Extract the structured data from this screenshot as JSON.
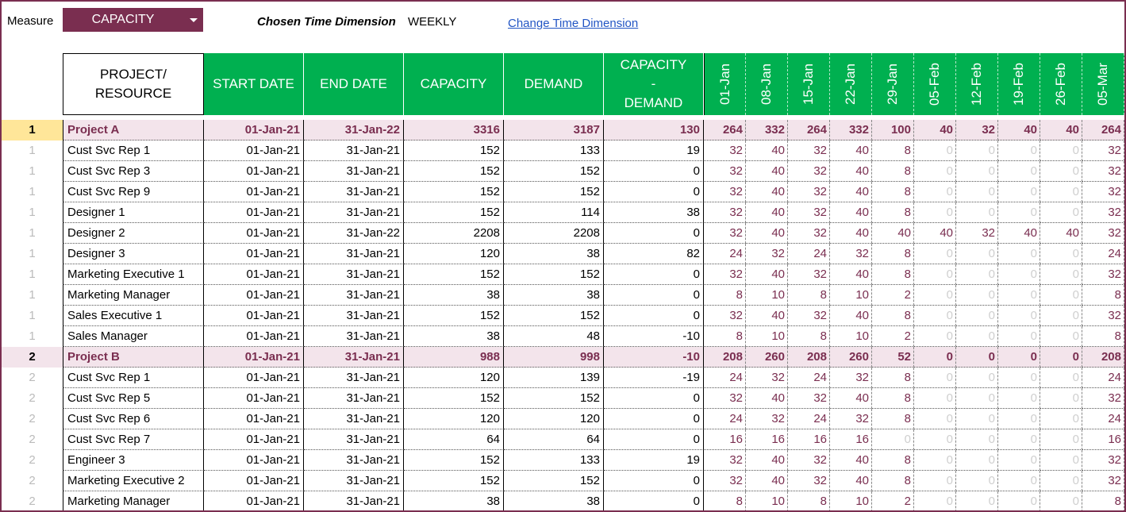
{
  "controls": {
    "measure_label": "Measure",
    "measure_value": "CAPACITY",
    "time_dimension_label": "Chosen Time Dimension",
    "time_dimension_value": "WEEKLY",
    "change_link": "Change Time Dimension"
  },
  "headers": {
    "project_line1": "PROJECT/",
    "project_line2": "RESOURCE",
    "start_date": "START DATE",
    "end_date": "END DATE",
    "capacity": "CAPACITY",
    "demand": "DEMAND",
    "cd_line1": "CAPACITY",
    "cd_line2": "-",
    "cd_line3": "DEMAND",
    "weeks": [
      "01-Jan",
      "08-Jan",
      "15-Jan",
      "22-Jan",
      "29-Jan",
      "05-Feb",
      "12-Feb",
      "19-Feb",
      "26-Feb",
      "05-Mar"
    ]
  },
  "rows": [
    {
      "idx": "1",
      "name": "Project A",
      "start": "01-Jan-21",
      "end": "31-Jan-22",
      "cap": "3316",
      "dem": "3187",
      "cd": "130",
      "weeks": [
        "264",
        "332",
        "264",
        "332",
        "100",
        "40",
        "32",
        "40",
        "40",
        "264"
      ],
      "project": true
    },
    {
      "idx": "1",
      "name": "Cust Svc Rep 1",
      "start": "01-Jan-21",
      "end": "31-Jan-21",
      "cap": "152",
      "dem": "133",
      "cd": "19",
      "weeks": [
        "32",
        "40",
        "32",
        "40",
        "8",
        "0",
        "0",
        "0",
        "0",
        "32"
      ]
    },
    {
      "idx": "1",
      "name": "Cust Svc Rep 3",
      "start": "01-Jan-21",
      "end": "31-Jan-21",
      "cap": "152",
      "dem": "152",
      "cd": "0",
      "weeks": [
        "32",
        "40",
        "32",
        "40",
        "8",
        "0",
        "0",
        "0",
        "0",
        "32"
      ]
    },
    {
      "idx": "1",
      "name": "Cust Svc Rep 9",
      "start": "01-Jan-21",
      "end": "31-Jan-21",
      "cap": "152",
      "dem": "152",
      "cd": "0",
      "weeks": [
        "32",
        "40",
        "32",
        "40",
        "8",
        "0",
        "0",
        "0",
        "0",
        "32"
      ]
    },
    {
      "idx": "1",
      "name": "Designer 1",
      "start": "01-Jan-21",
      "end": "31-Jan-21",
      "cap": "152",
      "dem": "114",
      "cd": "38",
      "weeks": [
        "32",
        "40",
        "32",
        "40",
        "8",
        "0",
        "0",
        "0",
        "0",
        "32"
      ]
    },
    {
      "idx": "1",
      "name": "Designer 2",
      "start": "01-Jan-21",
      "end": "31-Jan-22",
      "cap": "2208",
      "dem": "2208",
      "cd": "0",
      "weeks": [
        "32",
        "40",
        "32",
        "40",
        "40",
        "40",
        "32",
        "40",
        "40",
        "32"
      ]
    },
    {
      "idx": "1",
      "name": "Designer 3",
      "start": "01-Jan-21",
      "end": "31-Jan-21",
      "cap": "120",
      "dem": "38",
      "cd": "82",
      "weeks": [
        "24",
        "32",
        "24",
        "32",
        "8",
        "0",
        "0",
        "0",
        "0",
        "24"
      ]
    },
    {
      "idx": "1",
      "name": "Marketing Executive 1",
      "start": "01-Jan-21",
      "end": "31-Jan-21",
      "cap": "152",
      "dem": "152",
      "cd": "0",
      "weeks": [
        "32",
        "40",
        "32",
        "40",
        "8",
        "0",
        "0",
        "0",
        "0",
        "32"
      ]
    },
    {
      "idx": "1",
      "name": "Marketing Manager",
      "start": "01-Jan-21",
      "end": "31-Jan-21",
      "cap": "38",
      "dem": "38",
      "cd": "0",
      "weeks": [
        "8",
        "10",
        "8",
        "10",
        "2",
        "0",
        "0",
        "0",
        "0",
        "8"
      ]
    },
    {
      "idx": "1",
      "name": "Sales Executive 1",
      "start": "01-Jan-21",
      "end": "31-Jan-21",
      "cap": "152",
      "dem": "152",
      "cd": "0",
      "weeks": [
        "32",
        "40",
        "32",
        "40",
        "8",
        "0",
        "0",
        "0",
        "0",
        "32"
      ]
    },
    {
      "idx": "1",
      "name": "Sales Manager",
      "start": "01-Jan-21",
      "end": "31-Jan-21",
      "cap": "38",
      "dem": "48",
      "cd": "-10",
      "weeks": [
        "8",
        "10",
        "8",
        "10",
        "2",
        "0",
        "0",
        "0",
        "0",
        "8"
      ]
    },
    {
      "idx": "2",
      "name": "Project B",
      "start": "01-Jan-21",
      "end": "31-Jan-21",
      "cap": "988",
      "dem": "998",
      "cd": "-10",
      "weeks": [
        "208",
        "260",
        "208",
        "260",
        "52",
        "0",
        "0",
        "0",
        "0",
        "208"
      ],
      "project": true
    },
    {
      "idx": "2",
      "name": "Cust Svc Rep 1",
      "start": "01-Jan-21",
      "end": "31-Jan-21",
      "cap": "120",
      "dem": "139",
      "cd": "-19",
      "weeks": [
        "24",
        "32",
        "24",
        "32",
        "8",
        "0",
        "0",
        "0",
        "0",
        "24"
      ]
    },
    {
      "idx": "2",
      "name": "Cust Svc Rep 5",
      "start": "01-Jan-21",
      "end": "31-Jan-21",
      "cap": "152",
      "dem": "152",
      "cd": "0",
      "weeks": [
        "32",
        "40",
        "32",
        "40",
        "8",
        "0",
        "0",
        "0",
        "0",
        "32"
      ]
    },
    {
      "idx": "2",
      "name": "Cust Svc Rep 6",
      "start": "01-Jan-21",
      "end": "31-Jan-21",
      "cap": "120",
      "dem": "120",
      "cd": "0",
      "weeks": [
        "24",
        "32",
        "24",
        "32",
        "8",
        "0",
        "0",
        "0",
        "0",
        "24"
      ]
    },
    {
      "idx": "2",
      "name": "Cust Svc Rep 7",
      "start": "01-Jan-21",
      "end": "31-Jan-21",
      "cap": "64",
      "dem": "64",
      "cd": "0",
      "weeks": [
        "16",
        "16",
        "16",
        "16",
        "0",
        "0",
        "0",
        "0",
        "0",
        "16"
      ]
    },
    {
      "idx": "2",
      "name": "Engineer 3",
      "start": "01-Jan-21",
      "end": "31-Jan-21",
      "cap": "152",
      "dem": "133",
      "cd": "19",
      "weeks": [
        "32",
        "40",
        "32",
        "40",
        "8",
        "0",
        "0",
        "0",
        "0",
        "32"
      ]
    },
    {
      "idx": "2",
      "name": "Marketing Executive 2",
      "start": "01-Jan-21",
      "end": "31-Jan-21",
      "cap": "152",
      "dem": "152",
      "cd": "0",
      "weeks": [
        "32",
        "40",
        "32",
        "40",
        "8",
        "0",
        "0",
        "0",
        "0",
        "32"
      ]
    },
    {
      "idx": "2",
      "name": "Marketing Manager",
      "start": "01-Jan-21",
      "end": "31-Jan-21",
      "cap": "38",
      "dem": "38",
      "cd": "0",
      "weeks": [
        "8",
        "10",
        "8",
        "10",
        "2",
        "0",
        "0",
        "0",
        "0",
        "8"
      ]
    }
  ],
  "colors": {
    "accent": "#7a2e50",
    "header_green": "#00b050",
    "project_row_bg": "#f3e4eb",
    "selected_index_bg": "#ffe699",
    "link": "#2255c4"
  }
}
